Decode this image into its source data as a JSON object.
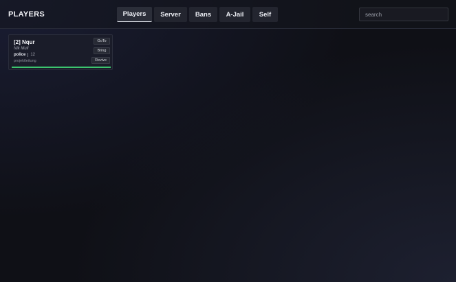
{
  "header": {
    "title": "PLAYERS",
    "tabs": [
      {
        "label": "Players",
        "active": true
      },
      {
        "label": "Server",
        "active": false
      },
      {
        "label": "Bans",
        "active": false
      },
      {
        "label": "A-Jail",
        "active": false
      },
      {
        "label": "Self",
        "active": false
      }
    ],
    "search": {
      "placeholder": "search",
      "value": ""
    }
  },
  "players": [
    {
      "name": "[2] Nqur",
      "character": "Nik Mull",
      "job": "police",
      "grade": "12",
      "rank": "projektleitung",
      "health": 1.0,
      "actions": [
        "GoTo",
        "Bring",
        "Revive"
      ]
    }
  ],
  "colors": {
    "accent": "#3cc46e",
    "background": "#0f1016",
    "card": "#1a1c29"
  }
}
